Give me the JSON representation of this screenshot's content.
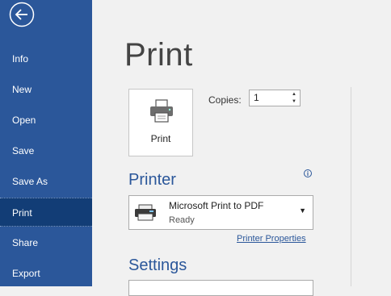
{
  "sidebar": {
    "back_icon": "back-arrow-icon",
    "items": [
      {
        "label": "Info"
      },
      {
        "label": "New"
      },
      {
        "label": "Open"
      },
      {
        "label": "Save"
      },
      {
        "label": "Save As"
      },
      {
        "label": "Print",
        "active": true
      },
      {
        "label": "Share"
      },
      {
        "label": "Export"
      }
    ]
  },
  "main": {
    "title": "Print",
    "print_button_label": "Print",
    "copies_label": "Copies:",
    "copies_value": "1",
    "printer_heading": "Printer",
    "printer": {
      "name": "Microsoft Print to PDF",
      "status": "Ready"
    },
    "printer_properties_link": "Printer Properties",
    "settings_heading": "Settings"
  },
  "colors": {
    "accent": "#2b579a",
    "active_nav": "#123d76",
    "background": "#f1f1f1"
  }
}
